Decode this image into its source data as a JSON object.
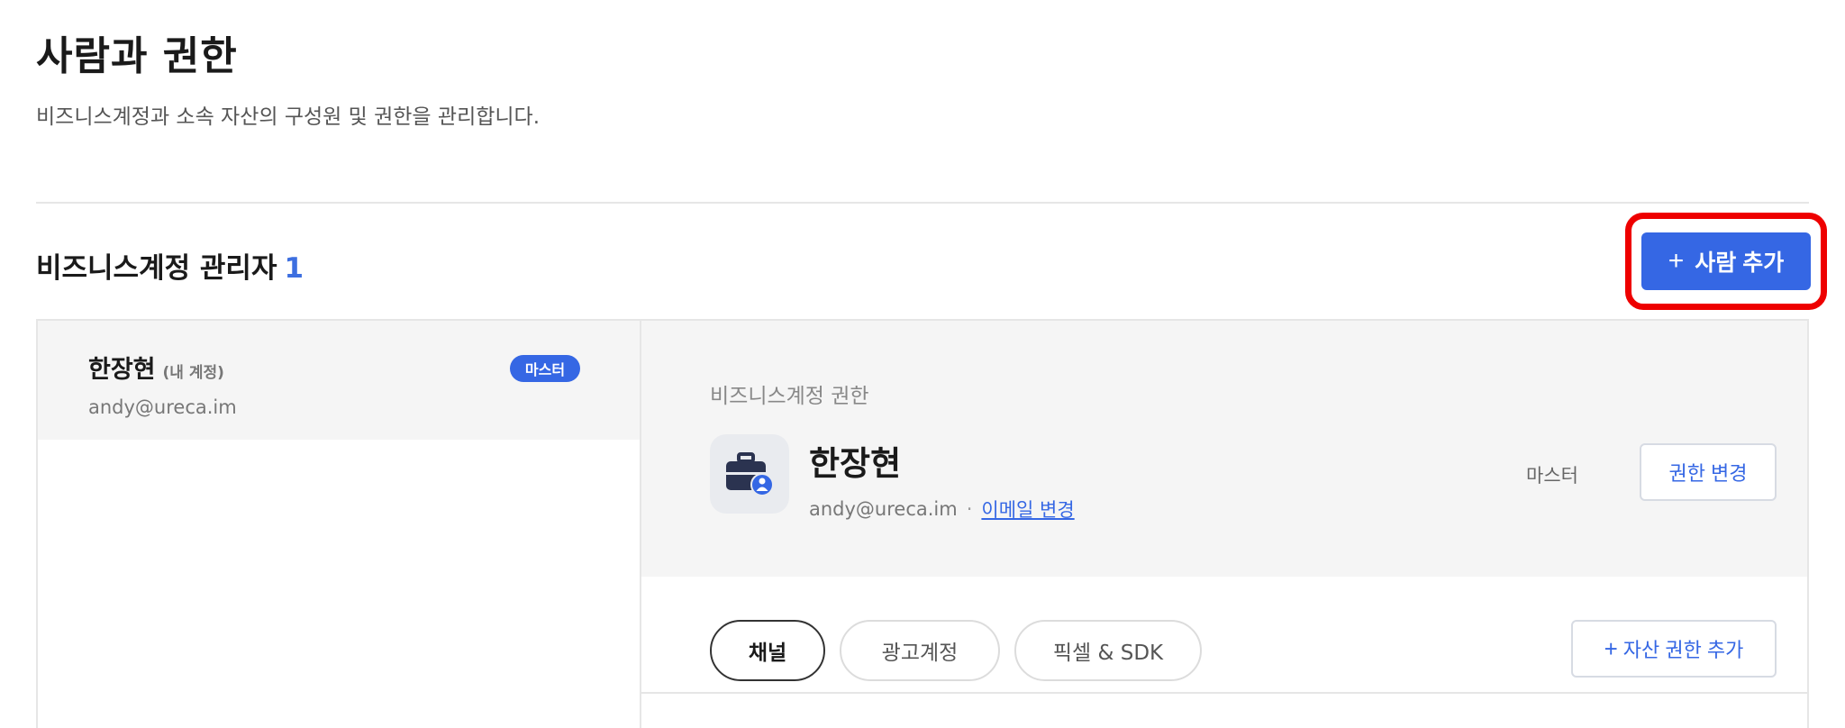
{
  "header": {
    "title": "사람과 권한",
    "subtitle": "비즈니스계정과 소속 자산의 구성원 및 권한을 관리합니다."
  },
  "section": {
    "title": "비즈니스계정 관리자",
    "count": "1",
    "add_person_label": "사람 추가",
    "add_person_plus": "+"
  },
  "member": {
    "name": "한장현",
    "note": "(내 계정)",
    "email": "andy@ureca.im",
    "badge": "마스터"
  },
  "detail": {
    "section_label": "비즈니스계정 권한",
    "name": "한장현",
    "email": "andy@ureca.im",
    "separator": "·",
    "email_change_link": "이메일 변경",
    "role": "마스터",
    "change_permission_label": "권한 변경"
  },
  "tabs": [
    {
      "label": "채널",
      "active": true
    },
    {
      "label": "광고계정",
      "active": false
    },
    {
      "label": "픽셀 & SDK",
      "active": false
    }
  ],
  "add_asset": {
    "plus": "+",
    "label": "자산 권한 추가"
  },
  "colors": {
    "accent": "#3567e4",
    "highlight": "#ee0000"
  }
}
